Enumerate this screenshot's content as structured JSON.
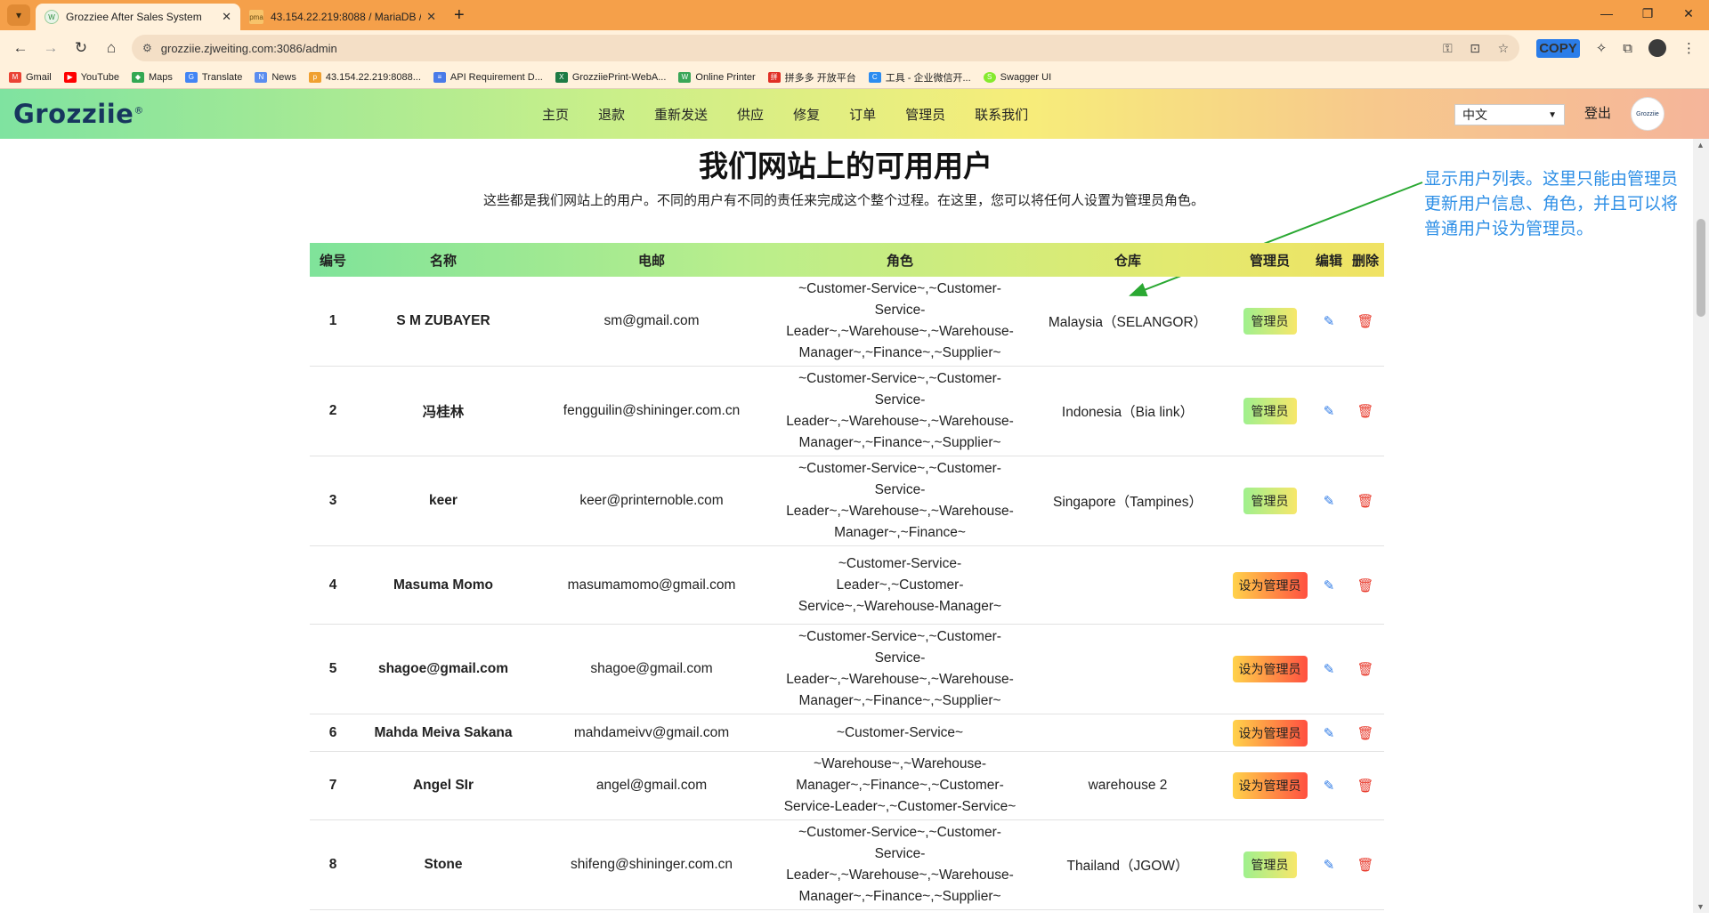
{
  "browser": {
    "tabs": [
      {
        "title": "Grozziee After Sales System",
        "active": true
      },
      {
        "title": "43.154.22.219:8088 / MariaDB /",
        "active": false
      }
    ],
    "url": "grozziie.zjweiting.com:3086/admin",
    "bookmarks": [
      "Gmail",
      "YouTube",
      "Maps",
      "Translate",
      "News",
      "43.154.22.219:8088...",
      "API Requirement D...",
      "GrozziiePrint-WebA...",
      "Online Printer",
      "拼多多 开放平台",
      "工具 - 企业微信开...",
      "Swagger UI"
    ],
    "copy_badge": "COPY"
  },
  "site": {
    "logo": "Grozziie",
    "logo_mark": "®",
    "nav": [
      "主页",
      "退款",
      "重新发送",
      "供应",
      "修复",
      "订单",
      "管理员",
      "联系我们"
    ],
    "language": "中文",
    "logout": "登出",
    "avatar_text": "Grozziie"
  },
  "page": {
    "title": "我们网站上的可用用户",
    "subtitle": "这些都是我们网站上的用户。不同的用户有不同的责任来完成这个整个过程。在这里，您可以将任何人设置为管理员角色。",
    "annotation": "显示用户列表。这里只能由管理员更新用户信息、角色，并且可以将普通用户设为管理员。"
  },
  "table": {
    "headers": [
      "编号",
      "名称",
      "电邮",
      "角色",
      "仓库",
      "管理员",
      "编辑",
      "删除"
    ],
    "admin_label": "管理员",
    "make_admin_label": "设为管理员",
    "rows": [
      {
        "id": "1",
        "name": "S M ZUBAYER",
        "email": "sm@gmail.com",
        "roles": [
          "~Customer-Service~,~Customer-",
          "Service-",
          "Leader~,~Warehouse~,~Warehouse-",
          "Manager~,~Finance~,~Supplier~"
        ],
        "warehouse": "Malaysia（SELANGOR）",
        "is_admin": true
      },
      {
        "id": "2",
        "name": "冯桂林",
        "email": "fengguilin@shininger.com.cn",
        "roles": [
          "~Customer-Service~,~Customer-",
          "Service-",
          "Leader~,~Warehouse~,~Warehouse-",
          "Manager~,~Finance~,~Supplier~"
        ],
        "warehouse": "Indonesia（Bia link）",
        "is_admin": true
      },
      {
        "id": "3",
        "name": "keer",
        "email": "keer@printernoble.com",
        "roles": [
          "~Customer-Service~,~Customer-",
          "Service-",
          "Leader~,~Warehouse~,~Warehouse-",
          "Manager~,~Finance~"
        ],
        "warehouse": "Singapore（Tampines）",
        "is_admin": true
      },
      {
        "id": "4",
        "name": "Masuma Momo",
        "email": "masumamomo@gmail.com",
        "roles": [
          "~Customer-Service-",
          "Leader~,~Customer-",
          "Service~,~Warehouse-Manager~"
        ],
        "warehouse": "",
        "is_admin": false
      },
      {
        "id": "5",
        "name": "shagoe@gmail.com",
        "email": "shagoe@gmail.com",
        "roles": [
          "~Customer-Service~,~Customer-",
          "Service-",
          "Leader~,~Warehouse~,~Warehouse-",
          "Manager~,~Finance~,~Supplier~"
        ],
        "warehouse": "",
        "is_admin": false
      },
      {
        "id": "6",
        "name": "Mahda Meiva Sakana",
        "email": "mahdameivv@gmail.com",
        "roles": [
          "~Customer-Service~"
        ],
        "warehouse": "",
        "is_admin": false
      },
      {
        "id": "7",
        "name": "Angel SIr",
        "email": "angel@gmail.com",
        "roles": [
          "~Warehouse~,~Warehouse-",
          "Manager~,~Finance~,~Customer-",
          "Service-Leader~,~Customer-Service~"
        ],
        "warehouse": "warehouse 2",
        "is_admin": false
      },
      {
        "id": "8",
        "name": "Stone",
        "email": "shifeng@shininger.com.cn",
        "roles": [
          "~Customer-Service~,~Customer-",
          "Service-",
          "Leader~,~Warehouse~,~Warehouse-",
          "Manager~,~Finance~,~Supplier~"
        ],
        "warehouse": "Thailand（JGOW）",
        "is_admin": true
      },
      {
        "id": "",
        "name": "",
        "email": "",
        "roles": [
          "~Customer-Service~,~Customer-"
        ],
        "warehouse": "",
        "is_admin": true
      }
    ]
  },
  "colors": {
    "tabbar": "#f5a04a",
    "annotation": "#2e8fe6",
    "edit_icon": "#2f7be6",
    "delete_icon": "#e8392b"
  }
}
